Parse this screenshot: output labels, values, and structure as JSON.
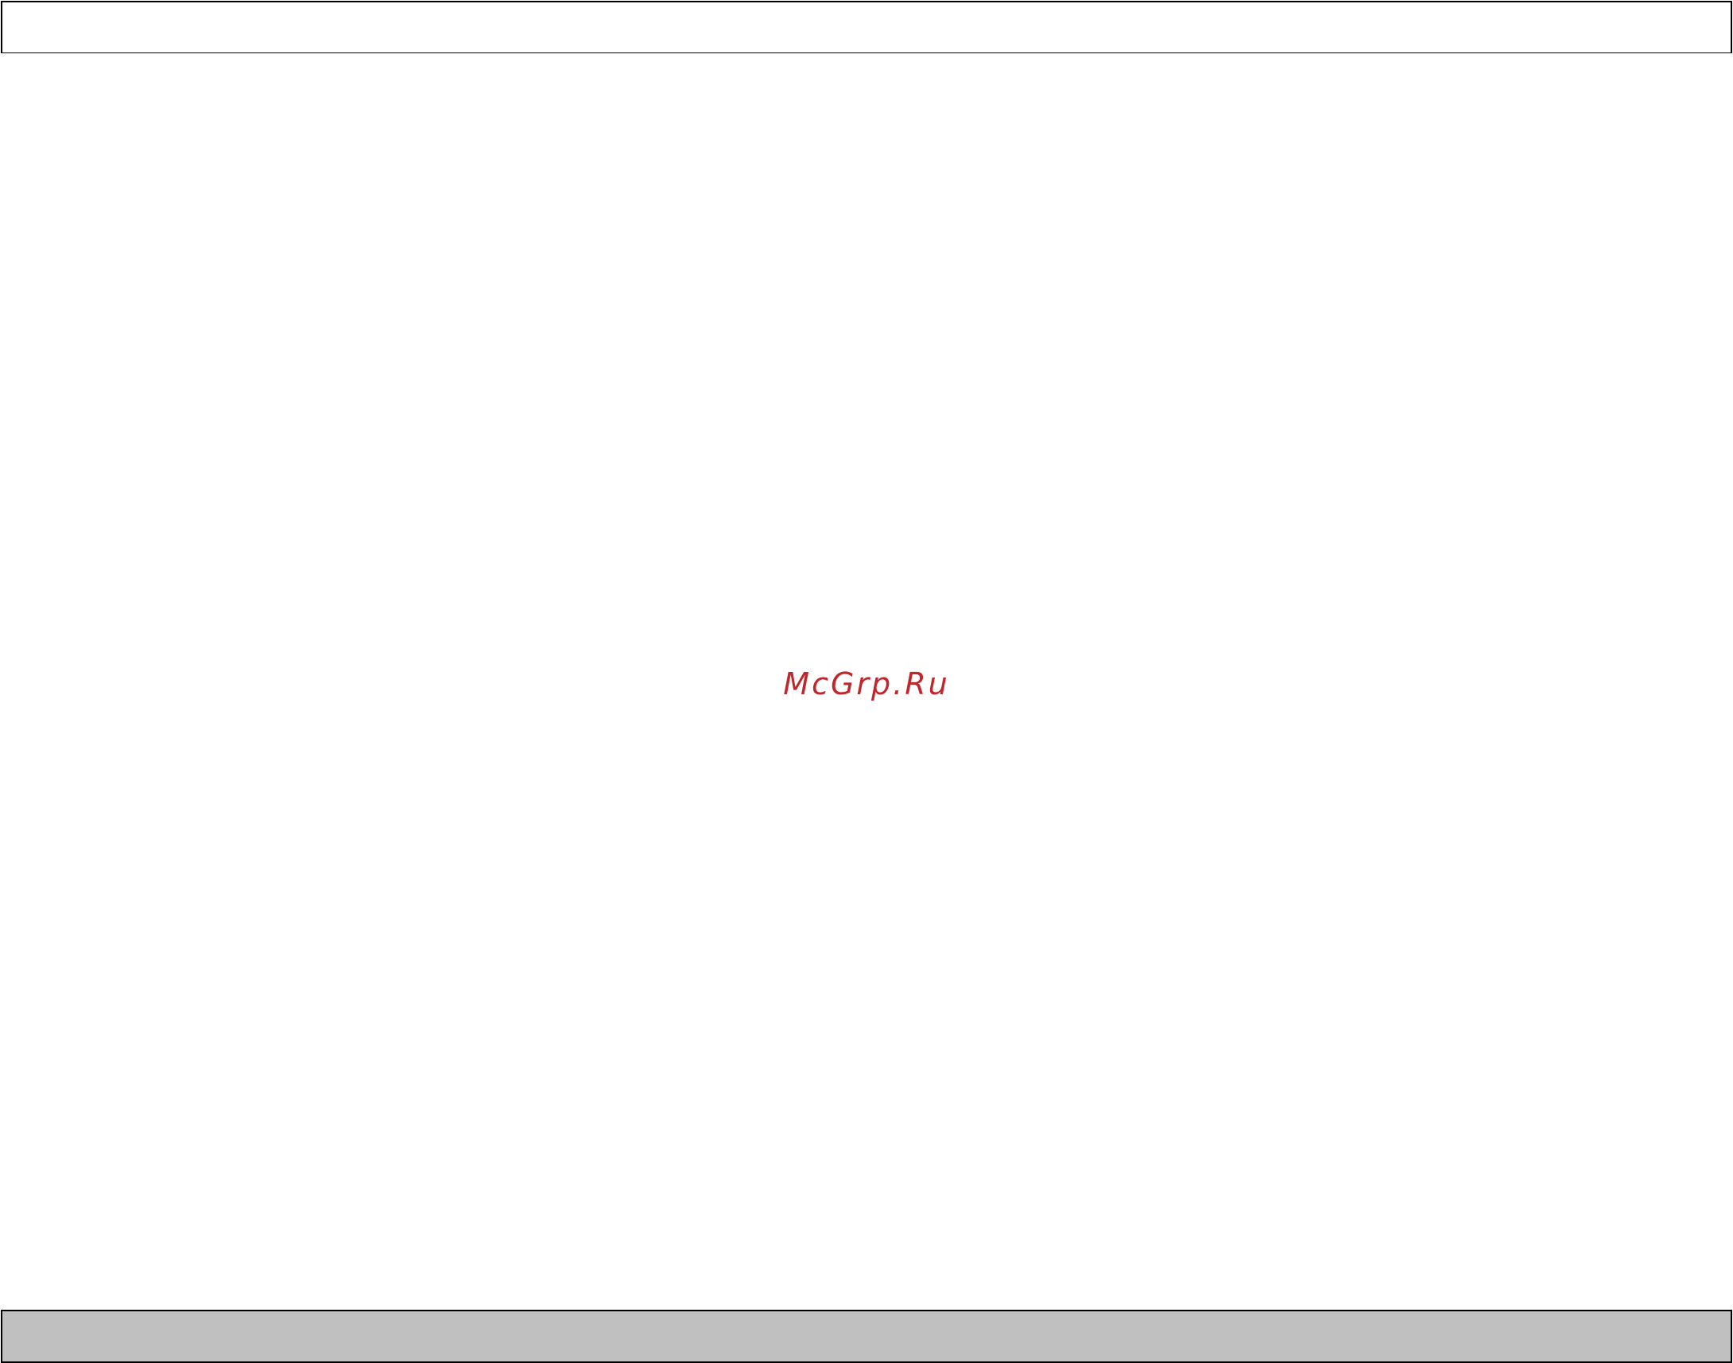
{
  "watermark": {
    "text": "McGrp.Ru",
    "color": "#c0272d"
  },
  "colors": {
    "header_background": "#ffffff",
    "footer_background": "#c0c0c0",
    "border": "#000000"
  }
}
